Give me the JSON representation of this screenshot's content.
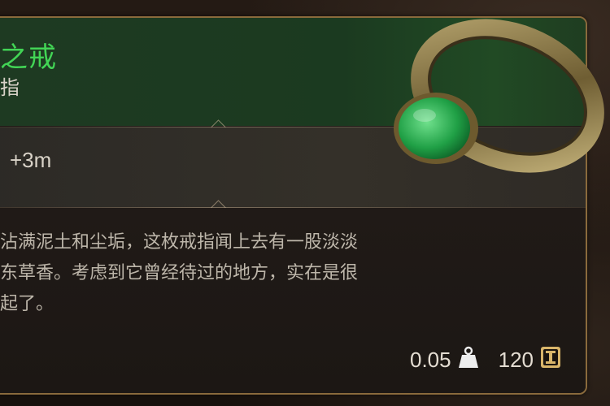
{
  "item": {
    "name_partial": "之戒",
    "type_partial": "指",
    "stat": "+3m",
    "description_lines": [
      "沾满泥土和尘垢，这枚戒指闻上去有一股淡淡",
      "东草香。考虑到它曾经待过的地方，实在是很",
      "起了。"
    ]
  },
  "footer": {
    "weight": "0.05",
    "price": "120",
    "weight_icon": "weight-icon",
    "price_icon": "coin-icon"
  },
  "colors": {
    "title": "#42d455",
    "frame": "#8a6a3c",
    "header_bg": "#1e3a22"
  }
}
